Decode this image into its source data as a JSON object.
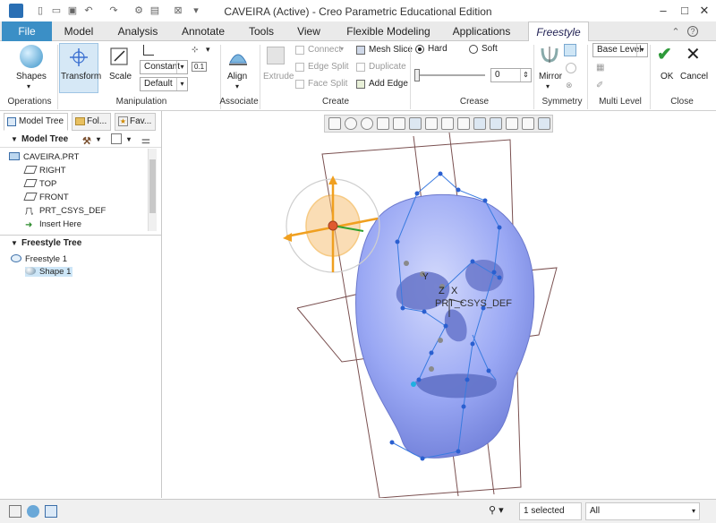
{
  "window": {
    "title": "CAVEIRA (Active) - Creo Parametric Educational Edition",
    "controls": [
      "–",
      "□",
      "✕"
    ]
  },
  "tabs": [
    {
      "label": "File"
    },
    {
      "label": "Model"
    },
    {
      "label": "Analysis"
    },
    {
      "label": "Annotate"
    },
    {
      "label": "Tools"
    },
    {
      "label": "View"
    },
    {
      "label": "Flexible Modeling"
    },
    {
      "label": "Applications"
    },
    {
      "label": "Freestyle"
    }
  ],
  "ribbon": {
    "shapes": "Shapes",
    "transform": "Transform",
    "scale": "Scale",
    "constant": "Constant",
    "default": "Default",
    "small_value": "0.1",
    "align": "Align",
    "extrude": "Extrude",
    "connect": "Connect",
    "edge_split": "Edge Split",
    "face_split": "Face Split",
    "mesh_slice": "Mesh Slice",
    "duplicate": "Duplicate",
    "add_edge": "Add Edge",
    "hard": "Hard",
    "soft": "Soft",
    "crease_value": "0",
    "mirror": "Mirror",
    "base_level": "Base Level",
    "ok": "OK",
    "cancel": "Cancel",
    "groups": {
      "operations": "Operations",
      "manipulation": "Manipulation",
      "associate": "Associate",
      "create": "Create",
      "crease": "Crease",
      "symmetry": "Symmetry",
      "multi_level": "Multi Level",
      "close": "Close"
    }
  },
  "panel": {
    "tabs": [
      "Model Tree",
      "Fol...",
      "Fav..."
    ],
    "model_tree_header": "Model Tree",
    "model_tree": [
      {
        "label": "CAVEIRA.PRT",
        "icon": "part-icon"
      },
      {
        "label": "RIGHT",
        "icon": "datum-plane-icon"
      },
      {
        "label": "TOP",
        "icon": "datum-plane-icon"
      },
      {
        "label": "FRONT",
        "icon": "datum-plane-icon"
      },
      {
        "label": "PRT_CSYS_DEF",
        "icon": "csys-icon"
      },
      {
        "label": "Insert Here",
        "icon": "insert-arrow-icon"
      }
    ],
    "freestyle_tree_header": "Freestyle Tree",
    "freestyle_tree": [
      {
        "label": "Freestyle 1",
        "icon": "freestyle-icon"
      },
      {
        "label": "Shape 1",
        "icon": "shape-sphere-icon"
      }
    ]
  },
  "viewport": {
    "csys_label": "PRT_CSYS_DEF",
    "axis_z": "Z",
    "axis_x": "X",
    "axis_y": "Y",
    "colors": {
      "mesh": "#9aa8f4",
      "cage": "#3a7be0",
      "dragger": "#f0a020",
      "frame": "#7a5050"
    }
  },
  "status": {
    "selected": "1 selected",
    "filter": "All"
  }
}
